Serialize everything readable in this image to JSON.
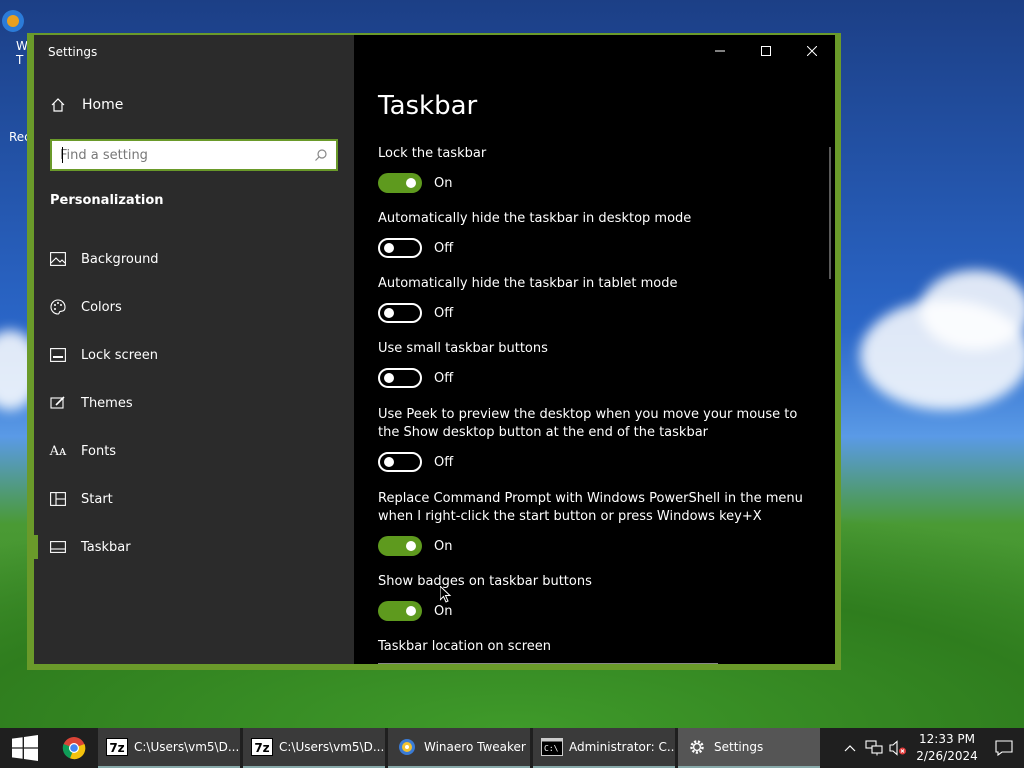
{
  "window": {
    "app_title": "Settings",
    "minimize": "minimize",
    "maximize": "maximize",
    "close": "close"
  },
  "sidebar": {
    "home_label": "Home",
    "search_placeholder": "Find a setting",
    "section_title": "Personalization",
    "items": [
      {
        "label": "Background",
        "icon": "picture-icon"
      },
      {
        "label": "Colors",
        "icon": "palette-icon"
      },
      {
        "label": "Lock screen",
        "icon": "lock-screen-icon"
      },
      {
        "label": "Themes",
        "icon": "themes-icon"
      },
      {
        "label": "Fonts",
        "icon": "fonts-icon"
      },
      {
        "label": "Start",
        "icon": "start-icon"
      },
      {
        "label": "Taskbar",
        "icon": "taskbar-icon",
        "active": true
      }
    ]
  },
  "page": {
    "title": "Taskbar",
    "settings": [
      {
        "label": "Lock the taskbar",
        "state": "On"
      },
      {
        "label": "Automatically hide the taskbar in desktop mode",
        "state": "Off"
      },
      {
        "label": "Automatically hide the taskbar in tablet mode",
        "state": "Off"
      },
      {
        "label": "Use small taskbar buttons",
        "state": "Off"
      },
      {
        "label": "Use Peek to preview the desktop when you move your mouse to the Show desktop button at the end of the taskbar",
        "state": "Off"
      },
      {
        "label": "Replace Command Prompt with Windows PowerShell in the menu when I right-click the start button or press Windows key+X",
        "state": "On"
      },
      {
        "label": "Show badges on taskbar buttons",
        "state": "On"
      }
    ],
    "location_label": "Taskbar location on screen"
  },
  "desktop": {
    "icon1_label": "W",
    "icon1_label2": "T",
    "icon2_label": "Rec"
  },
  "taskbar": {
    "tasks": [
      {
        "label": "C:\\Users\\vm5\\D...",
        "icon": "7zip-icon"
      },
      {
        "label": "C:\\Users\\vm5\\D...",
        "icon": "7zip-icon"
      },
      {
        "label": "Winaero Tweaker",
        "icon": "winaero-icon"
      },
      {
        "label": "Administrator: C...",
        "icon": "cmd-icon"
      },
      {
        "label": "Settings",
        "icon": "gear-icon",
        "active": true
      }
    ],
    "time": "12:33 PM",
    "date": "2/26/2024"
  },
  "colors": {
    "accent": "#6a9a2a",
    "toggle_on": "#5e9a1e",
    "sidebar_bg": "#2b2b2b",
    "content_bg": "#000000"
  }
}
